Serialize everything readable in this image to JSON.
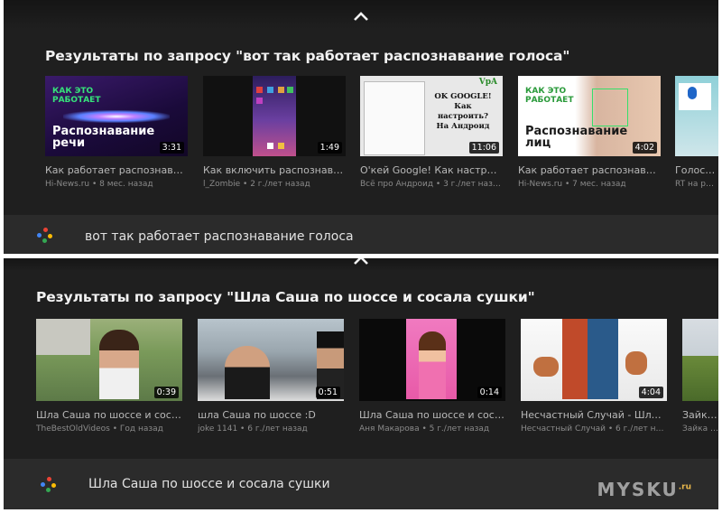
{
  "screen1": {
    "results_title": "Результаты по запросу \"вот так работает распознавание голоса\"",
    "query": "вот так работает распознавание голоса",
    "videos": [
      {
        "title": "Как работает распознаван...",
        "meta": "Hi-News.ru • 8 мес. назад",
        "duration": "3:31",
        "thumb_text_small": "КАК ЭТО\nРАБОТАЕТ",
        "thumb_text_big": "Распознавание\nречи"
      },
      {
        "title": "Как включить распознаван...",
        "meta": "l_Zombie • 2 г./лет назад",
        "duration": "1:49"
      },
      {
        "title": "О'кей Google! Как настроит...",
        "meta": "Всё про Андроид • 3 г./лет назад",
        "duration": "11:06",
        "thumb_text_big": "OK GOOGLE!\nКак настроить?\nНа Андроид",
        "thumb_badge": "VpA"
      },
      {
        "title": "Как работает распознаван...",
        "meta": "Hi-News.ru • 7 мес. назад",
        "duration": "4:02",
        "thumb_text_small": "КАК ЭТО\nРАБОТАЕТ",
        "thumb_text_big": "Распознавание\nлиц"
      },
      {
        "title": "Голосове",
        "meta": "RT на русс"
      }
    ]
  },
  "screen2": {
    "results_title": "Результаты по запросу \"Шла Саша по шоссе и сосала сушки\"",
    "query": "Шла Саша по шоссе и сосала сушки",
    "videos": [
      {
        "title": "Шла Саша по шоссе и соса...",
        "meta": "TheBestOldVideos • Год назад",
        "duration": "0:39"
      },
      {
        "title": "шла Саша по шоссе :D",
        "meta": "joke 1141 • 6 г./лет назад",
        "duration": "0:51"
      },
      {
        "title": "Шла Саша по шоссе и соса...",
        "meta": "Аня Макарова • 5 г./лет назад",
        "duration": "0:14"
      },
      {
        "title": "Несчастный Случай - Шла ...",
        "meta": "Несчастный Случай • 6 г./лет назад",
        "duration": "4:04"
      },
      {
        "title": "Зайка З",
        "meta": "Зайка Зай"
      }
    ]
  },
  "icons": {
    "chevron": "chevron-up-icon",
    "assistant": "google-assistant-icon"
  },
  "colors": {
    "assistant_blue": "#4285f4",
    "assistant_red": "#ea4335",
    "assistant_yellow": "#fbbc05",
    "assistant_green": "#34a853"
  },
  "watermark": {
    "text": "MYSKU",
    "suffix": ".ru"
  }
}
